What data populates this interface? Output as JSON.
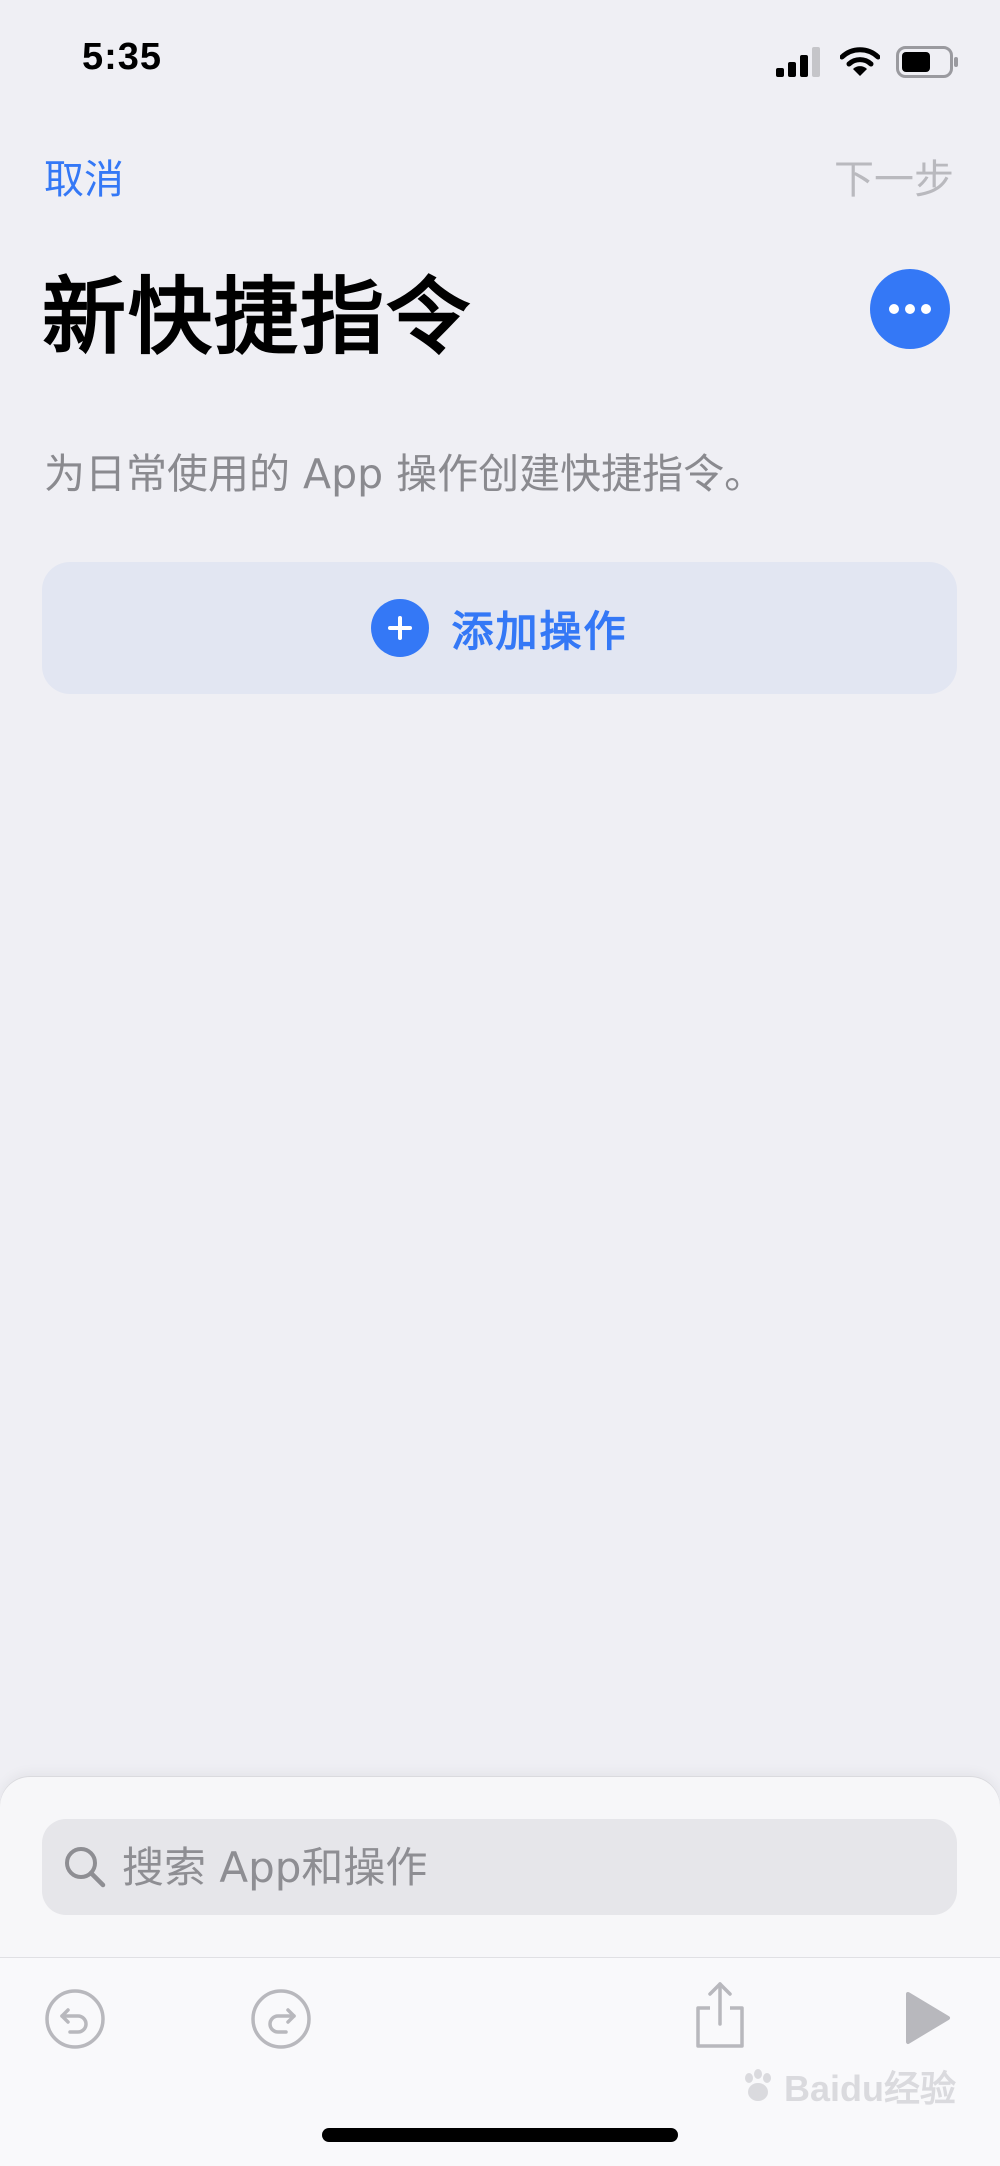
{
  "status_bar": {
    "time": "5:35",
    "icons": [
      "signal-icon",
      "wifi-icon",
      "battery-icon"
    ]
  },
  "nav": {
    "cancel_label": "取消",
    "next_label": "下一步"
  },
  "page": {
    "title": "新快捷指令",
    "description": "为日常使用的 App 操作创建快捷指令。",
    "more_icon": "ellipsis-icon"
  },
  "add_action": {
    "label": "添加操作",
    "icon": "plus-circle-icon"
  },
  "search": {
    "placeholder": "搜索 App和操作",
    "value": ""
  },
  "toolbar": {
    "icons": [
      "undo-icon",
      "redo-icon",
      "share-icon",
      "play-icon"
    ]
  },
  "watermark": {
    "text": "Baidu经验"
  },
  "colors": {
    "accent": "#3478f6",
    "background": "#efeff4",
    "secondary_text": "#8a8a8f",
    "disabled_text": "#b9b9be",
    "add_card_bg": "#e2e6f2"
  }
}
